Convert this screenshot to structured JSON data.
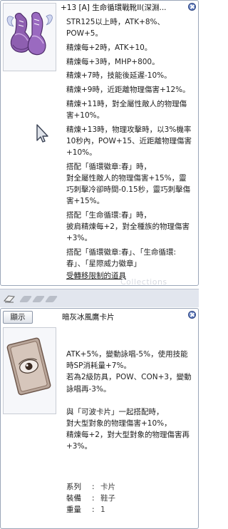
{
  "item_window": {
    "title": "+13 [A] 生命循環戰靴II(深淵...",
    "description": [
      "STR125以上時，ATK+8%、POW+5。",
      "精煉每+2時，ATK+10。",
      "精煉每+3時，MHP+800。",
      "精煉+7時，技能後延遲-10%。",
      "精煉+9時，近距離物理傷害+12%。",
      "精煉+11時，對全屬性敵人的物理傷害+10%。",
      "精煉+13時，物理攻擊時，以3%機率10秒內，POW+15、近距離物理傷害+10%。",
      "搭配「循環徽章:春」時，\n對全屬性敵人的物理傷害+15%，靈巧刺擊冷卻時間-0.15秒，靈巧刺擊傷害+15%。",
      "搭配「生命循環:春」時，\n披肩精煉每+2，對全種族的物理傷害+3%。",
      "搭配「循環徽章:春」、「生命循環:春」、「星際威力徽章」"
    ],
    "footer_link": "受轉移限制的道具",
    "watermark": "Collections"
  },
  "card_window": {
    "show_button": "顯示",
    "title": "暗灰冰風鷹卡片",
    "description": [
      "ATK+5%，變動詠唱-5%，使用技能時SP消耗量+7%。\n若為2級防具，POW、CON+3，變動詠唱再-3%。",
      "與「可波卡片」一起搭配時，\n對大型對象的物理傷害+10%，\n精煉每+2，對大型對象的物理傷害再+3%。"
    ],
    "properties": [
      {
        "key": "系列",
        "value": "卡片"
      },
      {
        "key": "裝備",
        "value": "鞋子"
      },
      {
        "key": "重量",
        "value": "1"
      }
    ]
  }
}
